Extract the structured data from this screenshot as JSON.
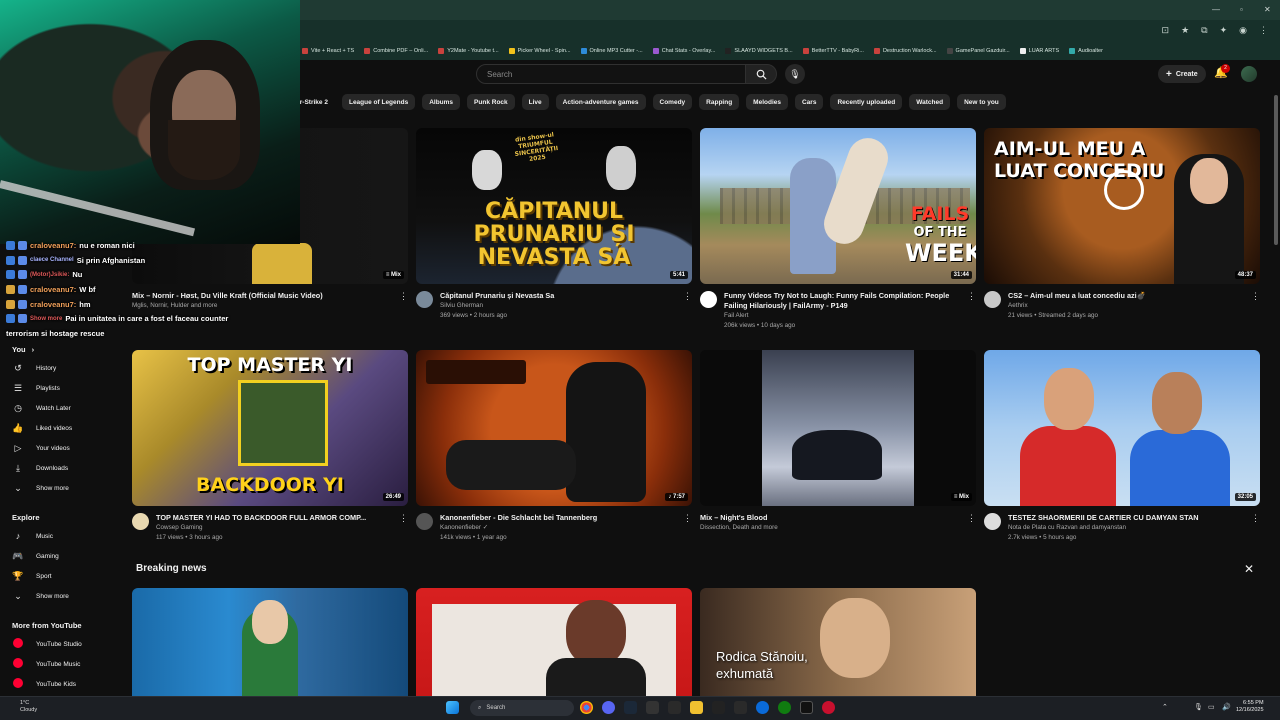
{
  "browser": {
    "bookmarks": [
      "Vite + React + TS",
      "Combine PDF – Onli...",
      "Y2Mate - Youtube t...",
      "Picker Wheel - Spin...",
      "Online MP3 Cutter -...",
      "Chat Stats - Overlay...",
      "SLAAYD WIDGETS B...",
      "BetterTTV - BabyRi...",
      "Destruction Warlock...",
      "GamePanel Gazduir...",
      "LUAR ARTS",
      "Audioalter"
    ]
  },
  "header": {
    "search_placeholder": "Search",
    "create_label": "Create",
    "notif_count": "2"
  },
  "chips": [
    "ter-Strike 2",
    "League of Legends",
    "Albums",
    "Punk Rock",
    "Live",
    "Action-adventure games",
    "Comedy",
    "Rapping",
    "Melodies",
    "Cars",
    "Recently uploaded",
    "Watched",
    "New to you"
  ],
  "chat": [
    {
      "user": "craloveanu7:",
      "msg": "nu e roman nici",
      "color": "#f0a05a"
    },
    {
      "user": "claece Channel",
      "msg": "Si prin Afghanistan",
      "color": "#a9b4ff"
    },
    {
      "user": "(Motor)Jsikie:",
      "msg": "Nu",
      "color": "#e05a5a"
    },
    {
      "user": "craloveanu7:",
      "msg": "W bf",
      "color": "#f0a05a"
    },
    {
      "user": "craloveanu7:",
      "msg": "hm",
      "color": "#f0a05a"
    },
    {
      "user": "Show more",
      "msg": "Pai in unitatea in care a fost el faceau counter",
      "color": "#e05a5a"
    },
    {
      "user": "",
      "msg": "terrorism si hostage rescue",
      "color": "#ffffff"
    }
  ],
  "sidebar": {
    "you_label": "You",
    "you_items": [
      {
        "label": "History",
        "icon": "history-icon"
      },
      {
        "label": "Playlists",
        "icon": "playlists-icon"
      },
      {
        "label": "Watch Later",
        "icon": "watch-later-icon"
      },
      {
        "label": "Liked videos",
        "icon": "liked-icon"
      },
      {
        "label": "Your videos",
        "icon": "your-videos-icon"
      },
      {
        "label": "Downloads",
        "icon": "downloads-icon"
      },
      {
        "label": "Show more",
        "icon": "chevron-down-icon"
      }
    ],
    "explore_label": "Explore",
    "explore_items": [
      {
        "label": "Music",
        "icon": "music-icon"
      },
      {
        "label": "Gaming",
        "icon": "gaming-icon"
      },
      {
        "label": "Sport",
        "icon": "sport-icon"
      },
      {
        "label": "Show more",
        "icon": "chevron-down-icon"
      }
    ],
    "more_label": "More from YouTube",
    "more_items": [
      {
        "label": "YouTube Studio"
      },
      {
        "label": "YouTube Music"
      },
      {
        "label": "YouTube Kids"
      }
    ]
  },
  "videos": [
    {
      "title": "Mix – Nornir - Høst, Du Ville Kraft (Official Music Video)",
      "line1": "Mglis, Nornir, Hulder and more",
      "line2": "",
      "duration": "Mix",
      "avatar": "none"
    },
    {
      "title": "Căpitanul Prunariu și Nevasta Sa",
      "line1": "Silviu Gherman",
      "line2": "369 views • 2 hours ago",
      "duration": "5:41",
      "thumb_text": "CĂPITANUL PRUNARIU ȘI NEVASTA SA",
      "thumb_small": "din show-ul TRIUMFUL SINCERITĂȚII 2025"
    },
    {
      "title": "Funny Videos Try Not to Laugh: Funny Fails Compilation: People Failing Hilariously | FailArmy - P149",
      "line1": "Fail Alert",
      "line2": "206k views • 10 days ago",
      "duration": "31:44",
      "thumb_text1": "FAILS",
      "thumb_text2": "OF THE",
      "thumb_text3": "WEEK"
    },
    {
      "title": "CS2 – Aim-ul meu a luat concediu azi💣",
      "line1": "Aethrix",
      "line2": "21 views • Streamed 2 days ago",
      "duration": "48:37",
      "thumb_text": "AIM-UL MEU A LUAT CONCEDIU"
    },
    {
      "title": "TOP MASTER YI HAD TO BACKDOOR FULL ARMOR COMP...",
      "line1": "Cowsep Gaming",
      "line2": "117 views • 3 hours ago",
      "duration": "26:49",
      "thumb_text1": "TOP MASTER YI",
      "thumb_text2": "BACKDOOR YI"
    },
    {
      "title": "Kanonenfieber - Die Schlacht bei Tannenberg",
      "line1": "Kanonenfieber ✓",
      "line2": "141k views • 1 year ago",
      "duration": "7:57"
    },
    {
      "title": "Mix – Night's Blood",
      "line1": "Dissection, Death and more",
      "line2": "",
      "duration": "Mix"
    },
    {
      "title": "TESTEZ SHAORMERII DE CARTIER CU DAMYAN STAN",
      "line1": "Nota de Plata cu Razvan and damyanstan",
      "line2": "2.7k views • 5 hours ago",
      "duration": "32:05"
    }
  ],
  "breaking": {
    "title": "Breaking news",
    "news3_caption1": "Rodica Stănoiu,",
    "news3_caption2": "exhumată"
  },
  "taskbar": {
    "temp": "1°C",
    "weather": "Cloudy",
    "search": "Search",
    "time": "6:55 PM",
    "date": "12/16/2025"
  }
}
